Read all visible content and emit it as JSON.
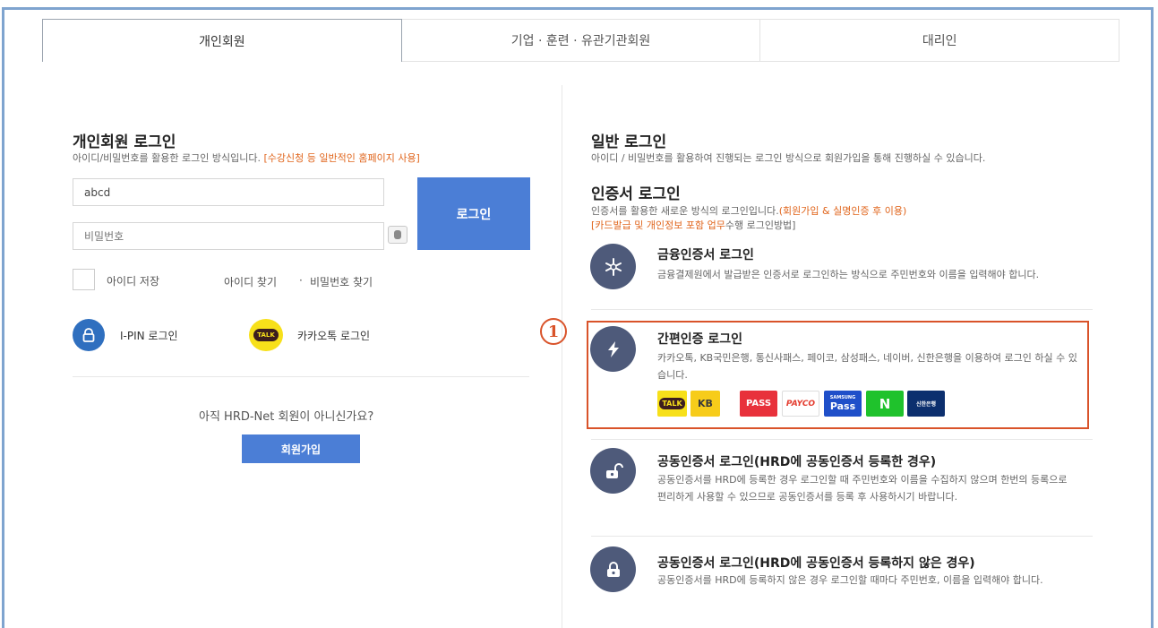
{
  "tabs": [
    {
      "label": "개인회원",
      "active": true
    },
    {
      "label": "기업 · 훈련 · 유관기관회원",
      "active": false
    },
    {
      "label": "대리인",
      "active": false
    }
  ],
  "personal": {
    "title": "개인회원 로그인",
    "desc": "아이디/비밀번호를 활용한 로그인 방식입니다.",
    "desc_highlight": "[수강신청 등 일반적인 홈페이지 사용]",
    "id_value": "abcd",
    "pw_placeholder": "비밀번호",
    "login_label": "로그인",
    "save_id_label": "아이디 저장",
    "find_id": "아이디 찾기",
    "separator": "·",
    "find_pw": "비밀번호 찾기",
    "ipin_label": "I-PIN 로그인",
    "kakao_label": "카카오톡 로그인",
    "kakao_icon_text": "TALK",
    "not_member": "아직 HRD-Net 회원이 아니신가요?",
    "join_label": "회원가입"
  },
  "general": {
    "title": "일반 로그인",
    "desc": "아이디 / 비밀번호를 활용하여 진행되는 로그인 방식으로 회원가입을 통해 진행하실 수 있습니다."
  },
  "cert": {
    "title": "인증서 로그인",
    "desc": "인증서를 활용한 새로운 방식의 로그인입니다.",
    "desc_highlight": "(회원가입 & 실명인증 후 이용)",
    "desc2_highlight": "[카드발급 및 개인정보 포함 업무",
    "desc2_rest": "수행 로그인방법]"
  },
  "methods": {
    "financial": {
      "title": "금융인증서 로그인",
      "desc": "금융결제원에서 발급받은 인증서로 로그인하는 방식으로 주민번호와 이름을 입력해야 합니다."
    },
    "simple": {
      "title": "간편인증 로그인",
      "desc": "카카오톡, KB국민은행, 통신사패스, 페이코, 삼성패스, 네이버, 신한은행을 이용하여 로그인 하실 수 있습니다.",
      "marker": "1"
    },
    "joint_registered": {
      "title": "공동인증서 로그인(HRD에 공동인증서 등록한 경우)",
      "desc": "공동인증서를 HRD에 등록한 경우 로그인할 때 주민번호와 이름을 수집하지 않으며 한번의 등록으로 편리하게 사용할 수 있으므로 공동인증서를 등록 후 사용하시기 바랍니다."
    },
    "joint_unregistered": {
      "title": "공동인증서 로그인(HRD에 공동인증서 등록하지 않은 경우)",
      "desc": "공동인증서를 HRD에 등록하지 않은 경우 로그인할 때마다 주민번호, 이름을 입력해야 합니다."
    }
  },
  "brands": {
    "kakao": "TALK",
    "kb": "KB",
    "pass": "PASS",
    "payco": "PAYCO",
    "samsung_small": "SAMSUNG",
    "samsung": "Pass",
    "naver": "N",
    "shinhan": "신한은행"
  },
  "colors": {
    "accent": "#4b7ed6",
    "highlight_border": "#d9532a",
    "orange_text": "#e0651c",
    "icon_bg": "#4e5a7a"
  }
}
